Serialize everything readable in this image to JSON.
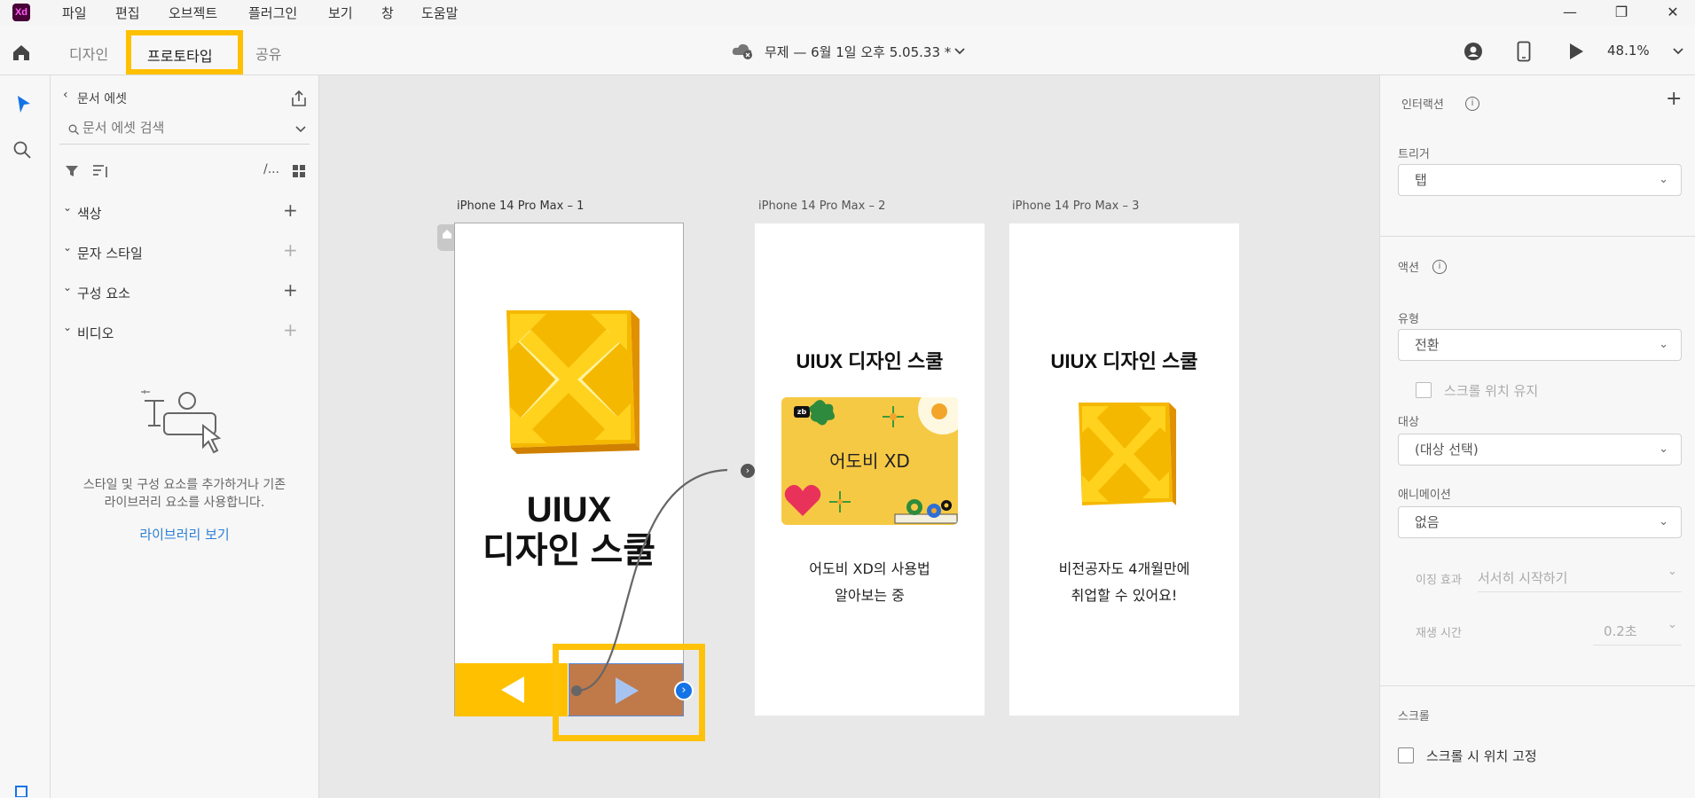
{
  "app": {
    "logo": "Xd"
  },
  "menu": [
    "파일",
    "편집",
    "오브젝트",
    "플러그인",
    "보기",
    "창",
    "도움말"
  ],
  "window_controls": {
    "minimize": "—",
    "maximize": "❐",
    "close": "✕"
  },
  "toolbar": {
    "tabs": [
      "디자인",
      "프로토타입",
      "공유"
    ],
    "active_tab": "프로토타입",
    "doc_title": "무제 — 6월 1일 오후 5.05.33 *",
    "zoom": "48.1%"
  },
  "assets": {
    "back_label": "문서 에셋",
    "search_placeholder": "문서 에셋 검색",
    "path_label": "/...",
    "sections": [
      "색상",
      "문자 스타일",
      "구성 요소",
      "비디오"
    ],
    "empty_text_1": "스타일 및 구성 요소를 추가하거나 기존",
    "empty_text_2": "라이브러리 요소를 사용합니다.",
    "library_link": "라이브러리 보기"
  },
  "artboards": [
    {
      "label": "iPhone 14 Pro Max – 1",
      "title_line1": "UIUX",
      "title_line2": "디자인 스쿨"
    },
    {
      "label": "iPhone 14 Pro Max – 2",
      "heading": "UIUX 디자인 스쿨",
      "card_text": "어도비 XD",
      "badge": "zb",
      "desc_line1": "어도비 XD의 사용법",
      "desc_line2": "알아보는 중"
    },
    {
      "label": "iPhone 14 Pro Max – 3",
      "heading": "UIUX 디자인 스쿨",
      "desc_line1": "비전공자도 4개월만에",
      "desc_line2": "취업할 수 있어요!"
    }
  ],
  "properties": {
    "interaction_title": "인터랙션",
    "trigger_label": "트리거",
    "trigger_value": "탭",
    "action_title": "액션",
    "type_label": "유형",
    "type_value": "전환",
    "preserve_scroll": "스크롤 위치 유지",
    "destination_label": "대상",
    "destination_value": "(대상 선택)",
    "animation_label": "애니메이션",
    "animation_value": "없음",
    "easing_label": "이징 효과",
    "easing_value": "서서히 시작하기",
    "duration_label": "재생 시간",
    "duration_value": "0.2초",
    "scroll_title": "스크롤",
    "fix_on_scroll": "스크롤 시 위치 고정"
  },
  "colors": {
    "accent_yellow": "#ffc000",
    "highlight": "#ffc20a",
    "link_blue": "#2d7fd6",
    "nav_brown": "#c07a4a"
  }
}
